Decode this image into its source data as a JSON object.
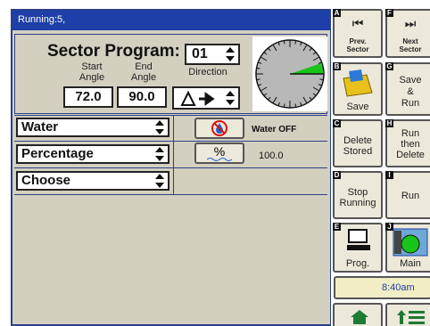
{
  "status": {
    "text": "Running:5,"
  },
  "sector": {
    "title": "Sector Program:",
    "number": "01",
    "start_label_1": "Start",
    "start_label_2": "Angle",
    "end_label_1": "End",
    "end_label_2": "Angle",
    "direction_label": "Direction",
    "start_angle": "72.0",
    "end_angle": "90.0",
    "direction_icon": "rotate-right-icon"
  },
  "rows": [
    {
      "select": "Water",
      "button_icon": "no-water-icon",
      "value": "Water OFF"
    },
    {
      "select": "Percentage",
      "button_icon": "percent-icon",
      "button_text": "%",
      "value": "100.0"
    },
    {
      "select": "Choose"
    }
  ],
  "side_buttons": {
    "A": {
      "key": "A",
      "line1": "Prev.",
      "line2": "Sector"
    },
    "F": {
      "key": "F",
      "line1": "Next",
      "line2": "Sector"
    },
    "B": {
      "key": "B",
      "label": "Save"
    },
    "G": {
      "key": "G",
      "line1": "Save",
      "line2": "&",
      "line3": "Run"
    },
    "C": {
      "key": "C",
      "line1": "Delete",
      "line2": "Stored"
    },
    "H": {
      "key": "H",
      "line1": "Run",
      "line2": "then",
      "line3": "Delete"
    },
    "D": {
      "key": "D",
      "line1": "Stop",
      "line2": "Running"
    },
    "I": {
      "key": "I",
      "label": "Run"
    },
    "E": {
      "key": "E",
      "label": "Prog."
    },
    "J": {
      "key": "J",
      "label": "Main"
    }
  },
  "time": "8:40am",
  "colors": {
    "status_bar": "#1e3fa8",
    "panel": "#d4d0c0",
    "dial_sector": "#19c419",
    "time_text": "#1a3fa3"
  }
}
